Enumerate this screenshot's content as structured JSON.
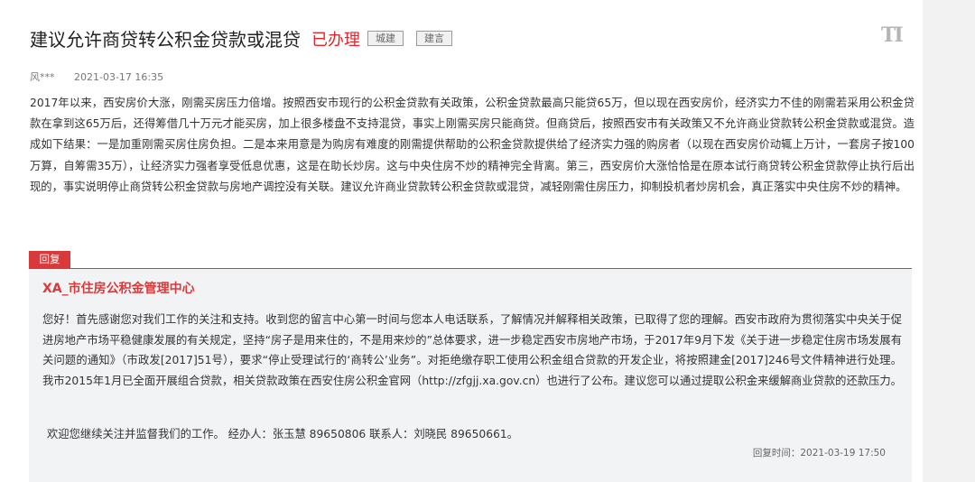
{
  "header": {
    "title": "建议允许商贷转公积金贷款或混贷",
    "status": "已办理",
    "tags": [
      "城建",
      "建言"
    ],
    "font_size_toggle": "TI"
  },
  "meta": {
    "author": "风***",
    "date": "2021-03-17 16:35"
  },
  "message": {
    "content": "2017年以来，西安房价大涨，刚需买房压力倍增。按照西安市现行的公积金贷款有关政策，公积金贷款最高只能贷65万，但以现在西安房价，经济实力不佳的刚需若采用公积金贷款在拿到这65万后，还得筹借几十万元才能买房，加上很多楼盘不支持混贷，事实上刚需买房只能商贷。但商贷后，按照西安市有关政策又不允许商业贷款转公积金贷款或混贷。造成如下结果：一是加重刚需买房住房负担。二是本来用意是为购房有难度的刚需提供帮助的公积金贷款提供给了经济实力强的购房者（以现在西安房价动辄上万计，一套房子按100万算，自筹需35万），让经济实力强者享受低息优惠，这是在助长炒房。这与中央住房不炒的精神完全背离。第三，西安房价大涨恰恰是在原本试行商贷转公积金贷款停止执行后出现的，事实说明停止商贷转公积金贷款与房地产调控没有关联。建议允许商业贷款转公积金贷款或混贷，减轻刚需住房压力，抑制投机者炒房机会，真正落实中央住房不炒的精神。"
  },
  "reply": {
    "badge": "回复",
    "department": "XA_市住房公积金管理中心",
    "content": "您好！首先感谢您对我们工作的关注和支持。收到您的留言中心第一时间与您本人电话联系，了解情况并解释相关政策，已取得了您的理解。西安市政府为贯彻落实中央关于促进房地产市场平稳健康发展的有关规定，坚持“房子是用来住的，不是用来炒的”总体要求，进一步稳定西安市房地产市场，于2017年9月下发《关于进一步稳定住房市场发展有关问题的通知》（市政发[2017]51号），要求“停止受理试行的‘商转公’业务”。对拒绝缴存职工使用公积金组合贷款的开发企业，将按照建金[2017]246号文件精神进行处理。我市2015年1月已全面开展组合贷款，相关贷款政策在西安住房公积金官网（http://zfgjj.xa.gov.cn）也进行了公布。建议您可以通过提取公积金来缓解商业贷款的还款压力。",
    "closing": "欢迎您继续关注并监督我们的工作。 经办人：张玉慧 89650806 联系人：刘晓民 89650661。",
    "time": "回复时间：2021-03-19 17:50"
  }
}
